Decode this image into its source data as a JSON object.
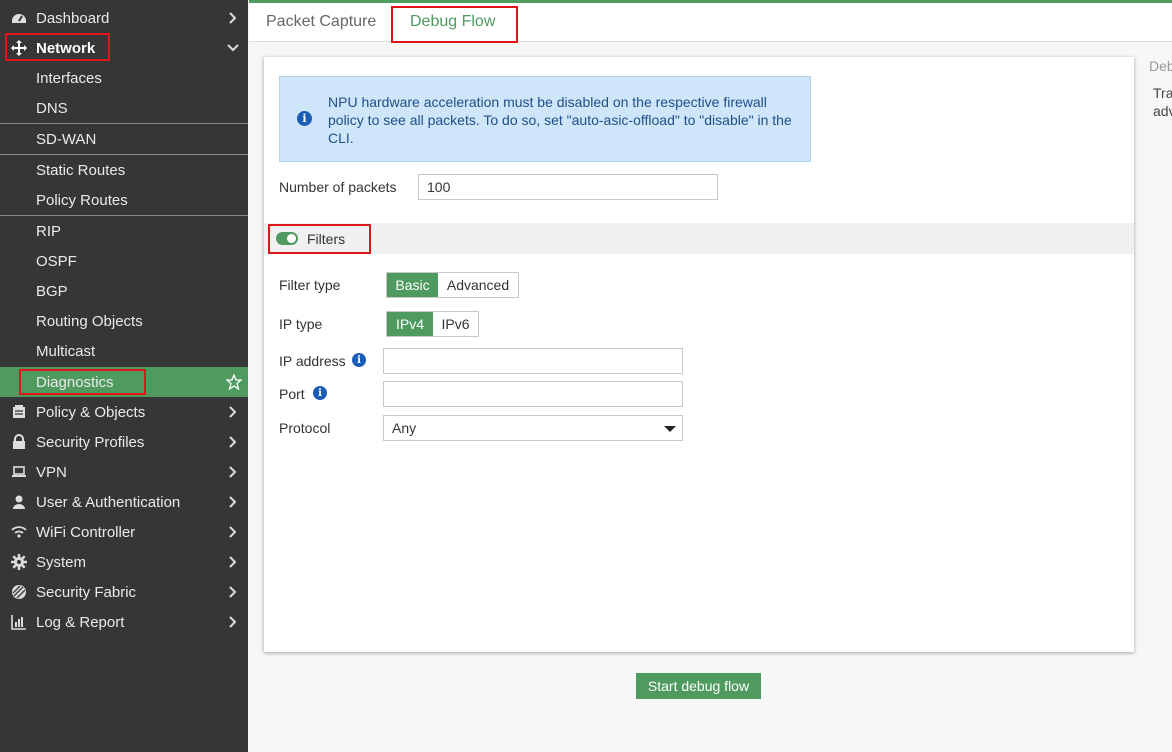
{
  "sidebar": {
    "items": [
      {
        "label": "Dashboard",
        "icon": "dashboard-icon"
      },
      {
        "label": "Network",
        "icon": "network-icon"
      },
      {
        "label": "Interfaces"
      },
      {
        "label": "DNS"
      },
      {
        "label": "SD-WAN"
      },
      {
        "label": "Static Routes"
      },
      {
        "label": "Policy Routes"
      },
      {
        "label": "RIP"
      },
      {
        "label": "OSPF"
      },
      {
        "label": "BGP"
      },
      {
        "label": "Routing Objects"
      },
      {
        "label": "Multicast"
      },
      {
        "label": "Diagnostics",
        "icon": "star-icon"
      },
      {
        "label": "Policy & Objects",
        "icon": "policy-icon"
      },
      {
        "label": "Security Profiles",
        "icon": "lock-icon"
      },
      {
        "label": "VPN",
        "icon": "laptop-icon"
      },
      {
        "label": "User & Authentication",
        "icon": "user-icon"
      },
      {
        "label": "WiFi Controller",
        "icon": "wifi-icon"
      },
      {
        "label": "System",
        "icon": "gear-icon"
      },
      {
        "label": "Security Fabric",
        "icon": "fabric-icon"
      },
      {
        "label": "Log & Report",
        "icon": "chart-icon"
      }
    ]
  },
  "tabs": [
    {
      "label": "Packet Capture"
    },
    {
      "label": "Debug Flow"
    }
  ],
  "info_message": "NPU hardware acceleration must be disabled on the respective firewall policy to see all packets. To do so, set \"auto-asic-offload\" to \"disable\" in the CLI.",
  "form": {
    "num_packets_label": "Number of packets",
    "num_packets_value": "100",
    "filters_label": "Filters",
    "filter_type_label": "Filter type",
    "filter_type_options": [
      "Basic",
      "Advanced"
    ],
    "ip_type_label": "IP type",
    "ip_type_options": [
      "IPv4",
      "IPv6"
    ],
    "ip_address_label": "IP address",
    "port_label": "Port",
    "protocol_label": "Protocol",
    "protocol_value": "Any"
  },
  "start_button": "Start debug flow",
  "right_panel": {
    "title": "Deb",
    "line1": "Tra",
    "line2": "adv"
  },
  "colors": {
    "accent": "#4e9a5f",
    "sidebar_bg": "#363636",
    "highlight": "#e0141b",
    "info_bg": "#cfe5f9"
  }
}
